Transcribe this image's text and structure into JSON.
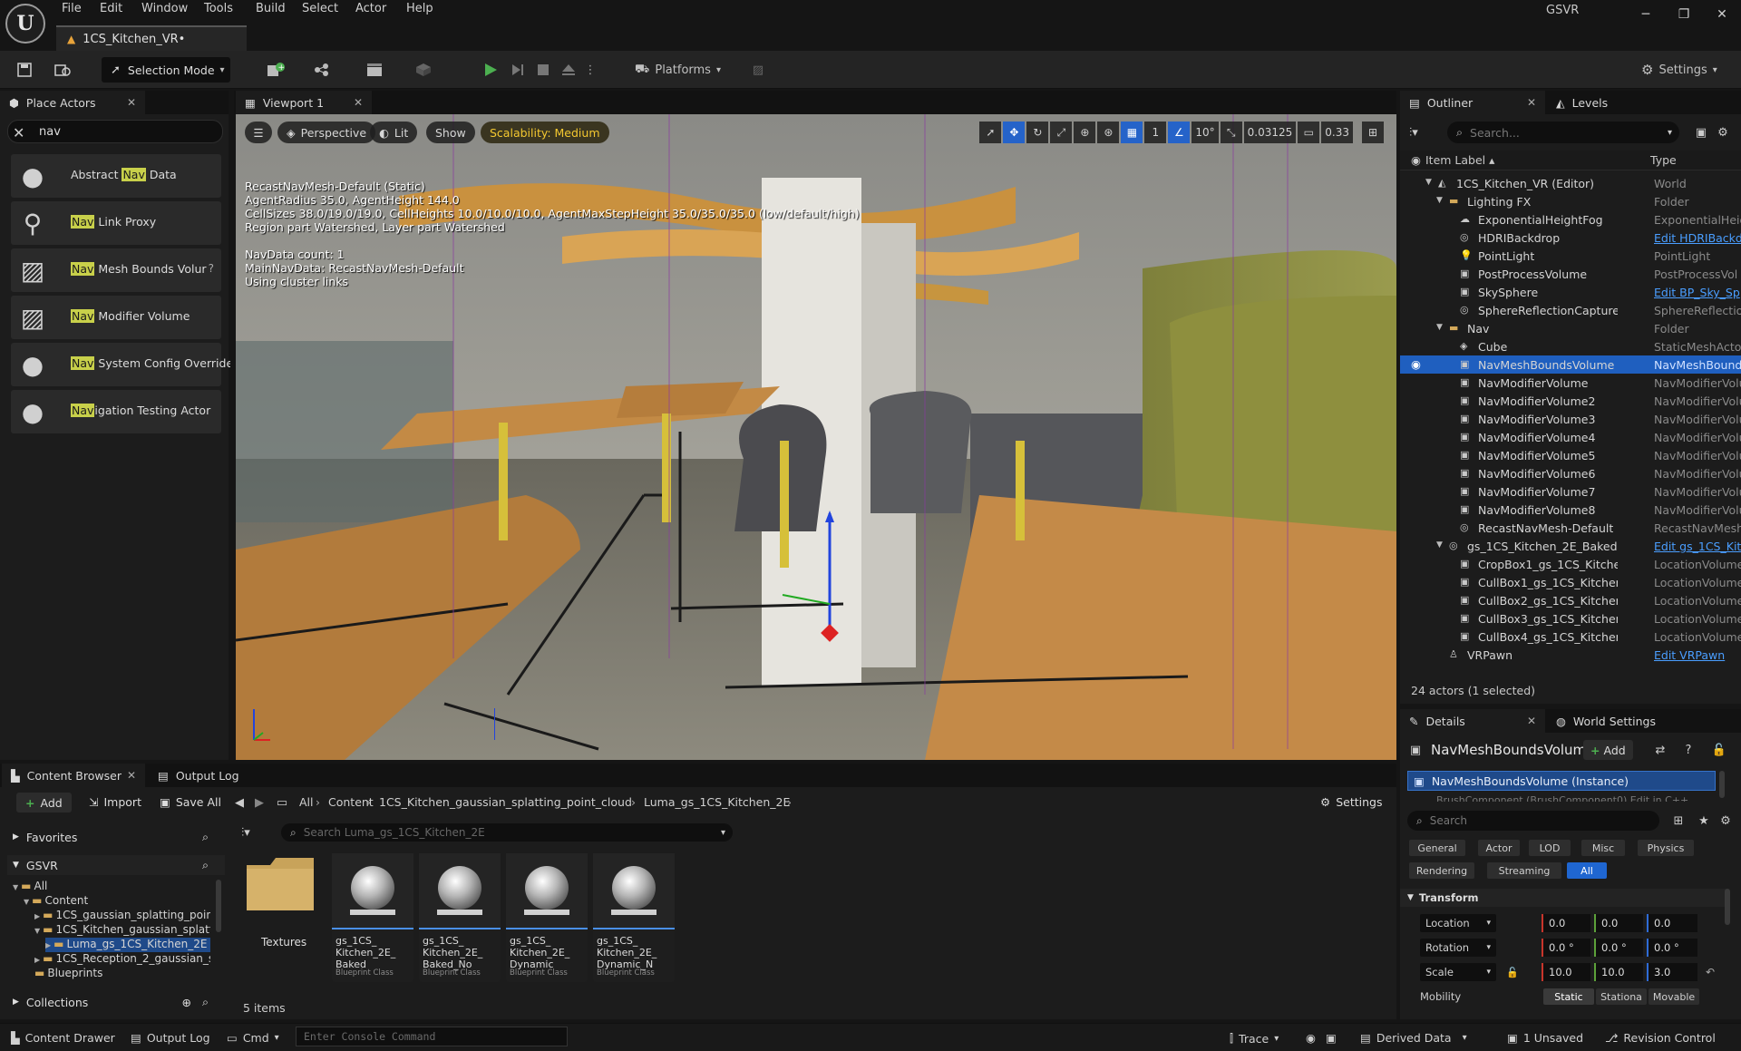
{
  "menu": [
    "File",
    "Edit",
    "Window",
    "Tools",
    "Build",
    "Select",
    "Actor",
    "Help"
  ],
  "project_tab": "1CS_Kitchen_VR•",
  "top_right_label": "GSVR",
  "toolbar": {
    "selection_mode": "Selection Mode",
    "platforms": "Platforms",
    "settings": "Settings"
  },
  "place_actors": {
    "tab": "Place Actors",
    "search_value": "nav",
    "items": [
      {
        "pre": "Abstract ",
        "hl": "Nav",
        "post": " Data"
      },
      {
        "pre": "",
        "hl": "Nav",
        "post": " Link Proxy"
      },
      {
        "pre": "",
        "hl": "Nav",
        "post": " Mesh Bounds Volur"
      },
      {
        "pre": "",
        "hl": "Nav",
        "post": " Modifier Volume"
      },
      {
        "pre": "",
        "hl": "Nav",
        "post": " System Config Override"
      },
      {
        "pre": "",
        "hl": "Nav",
        "post": "igation Testing Actor"
      }
    ]
  },
  "viewport": {
    "tab": "Viewport 1",
    "perspective": "Perspective",
    "lit": "Lit",
    "show": "Show",
    "scalability": "Scalability: Medium",
    "grid_snap": "1",
    "rotation_snap": "10°",
    "scale_snap": "0.03125",
    "camera_speed": "0.33",
    "nav_info": "RecastNavMesh-Default (Static)\nAgentRadius 35.0, AgentHeight 144.0\nCellSizes 38.0/19.0/19.0, CellHeights 10.0/10.0/10.0, AgentMaxStepHeight 35.0/35.0/35.0 (low/default/high)\nRegion part Watershed, Layer part Watershed\n\nNavData count: 1\nMainNavData: RecastNavMesh-Default\nUsing cluster links"
  },
  "outliner": {
    "tab": "Outliner",
    "levels_tab": "Levels",
    "search_placeholder": "Search...",
    "col_label": "Item Label",
    "col_type": "Type",
    "rows": [
      {
        "name": "1CS_Kitchen_VR (Editor)",
        "type": "World",
        "indent": 0,
        "kind": "world",
        "expand": "open"
      },
      {
        "name": "Lighting FX",
        "type": "Folder",
        "indent": 1,
        "kind": "folder",
        "expand": "open"
      },
      {
        "name": "ExponentialHeightFog",
        "type": "ExponentialHeig",
        "indent": 2,
        "kind": "fog"
      },
      {
        "name": "HDRIBackdrop",
        "type": "Edit HDRIBackd",
        "indent": 2,
        "kind": "actor",
        "link": true
      },
      {
        "name": "PointLight",
        "type": "PointLight",
        "indent": 2,
        "kind": "light"
      },
      {
        "name": "PostProcessVolume",
        "type": "PostProcessVol",
        "indent": 2,
        "kind": "volume"
      },
      {
        "name": "SkySphere",
        "type": "Edit BP_Sky_Sp",
        "indent": 2,
        "kind": "volume",
        "link": true
      },
      {
        "name": "SphereReflectionCapture",
        "type": "SphereReflectio",
        "indent": 2,
        "kind": "actor"
      },
      {
        "name": "Nav",
        "type": "Folder",
        "indent": 1,
        "kind": "folder",
        "expand": "open"
      },
      {
        "name": "Cube",
        "type": "StaticMeshActo",
        "indent": 2,
        "kind": "cube"
      },
      {
        "name": "NavMeshBoundsVolume",
        "type": "NavMeshBound",
        "indent": 2,
        "kind": "volume",
        "selected": true
      },
      {
        "name": "NavModifierVolume",
        "type": "NavModifierVolu",
        "indent": 2,
        "kind": "volume"
      },
      {
        "name": "NavModifierVolume2",
        "type": "NavModifierVolu",
        "indent": 2,
        "kind": "volume"
      },
      {
        "name": "NavModifierVolume3",
        "type": "NavModifierVolu",
        "indent": 2,
        "kind": "volume"
      },
      {
        "name": "NavModifierVolume4",
        "type": "NavModifierVolu",
        "indent": 2,
        "kind": "volume"
      },
      {
        "name": "NavModifierVolume5",
        "type": "NavModifierVolu",
        "indent": 2,
        "kind": "volume"
      },
      {
        "name": "NavModifierVolume6",
        "type": "NavModifierVolu",
        "indent": 2,
        "kind": "volume"
      },
      {
        "name": "NavModifierVolume7",
        "type": "NavModifierVolu",
        "indent": 2,
        "kind": "volume"
      },
      {
        "name": "NavModifierVolume8",
        "type": "NavModifierVolu",
        "indent": 2,
        "kind": "volume"
      },
      {
        "name": "RecastNavMesh-Default",
        "type": "RecastNavMesh",
        "indent": 2,
        "kind": "actor"
      },
      {
        "name": "gs_1CS_Kitchen_2E_Baked",
        "type": "Edit gs_1CS_Kit",
        "indent": 1,
        "kind": "actor",
        "expand": "open",
        "link": true
      },
      {
        "name": "CropBox1_gs_1CS_Kitchen_2E_",
        "type": "LocationVolume",
        "indent": 2,
        "kind": "volume"
      },
      {
        "name": "CullBox1_gs_1CS_Kitchen_2E_E",
        "type": "LocationVolume",
        "indent": 2,
        "kind": "volume"
      },
      {
        "name": "CullBox2_gs_1CS_Kitchen_2E_E",
        "type": "LocationVolume",
        "indent": 2,
        "kind": "volume"
      },
      {
        "name": "CullBox3_gs_1CS_Kitchen_2E_E",
        "type": "LocationVolume",
        "indent": 2,
        "kind": "volume"
      },
      {
        "name": "CullBox4_gs_1CS_Kitchen_2E_E",
        "type": "LocationVolume",
        "indent": 2,
        "kind": "volume"
      },
      {
        "name": "VRPawn",
        "type": "Edit VRPawn",
        "indent": 1,
        "kind": "pawn",
        "link": true
      }
    ],
    "count": "24 actors (1 selected)"
  },
  "details": {
    "tab": "Details",
    "world_settings_tab": "World Settings",
    "object_name": "NavMeshBoundsVolum",
    "add": "Add",
    "instance": "NavMeshBoundsVolume (Instance)",
    "component_partial": "BrushComponent (BrushComponent0)   Edit in C++",
    "search_placeholder": "Search",
    "categories": [
      "General",
      "Actor",
      "LOD",
      "Misc",
      "Physics",
      "Rendering",
      "Streaming",
      "All"
    ],
    "transform_header": "Transform",
    "location_label": "Location",
    "rotation_label": "Rotation",
    "scale_label": "Scale",
    "location": [
      "0.0",
      "0.0",
      "0.0"
    ],
    "rotation": [
      "0.0 °",
      "0.0 °",
      "0.0 °"
    ],
    "scale": [
      "10.0",
      "10.0",
      "3.0"
    ],
    "mobility_label": "Mobility",
    "mobility_options": [
      "Static",
      "Stationa",
      "Movable"
    ]
  },
  "content_browser": {
    "tab": "Content Browser",
    "output_log_tab": "Output Log",
    "add": "Add",
    "import": "Import",
    "save_all": "Save All",
    "settings": "Settings",
    "crumbs": [
      "All",
      "Content",
      "1CS_Kitchen_gaussian_splatting_point_cloud",
      "Luma_gs_1CS_Kitchen_2E"
    ],
    "favorites": "Favorites",
    "project": "GSVR",
    "collections": "Collections",
    "tree": [
      "All",
      "Content",
      "1CS_gaussian_splatting_point",
      "1CS_Kitchen_gaussian_splatti",
      "Luma_gs_1CS_Kitchen_2E",
      "1CS_Reception_2_gaussian_s",
      "Blueprints"
    ],
    "search_placeholder": "Search Luma_gs_1CS_Kitchen_2E",
    "folder": "Textures",
    "assets": [
      {
        "name": "gs_1CS_ Kitchen_2E_ Baked",
        "cls": "Blueprint Class"
      },
      {
        "name": "gs_1CS_ Kitchen_2E_ Baked_No",
        "cls": "Blueprint Class"
      },
      {
        "name": "gs_1CS_ Kitchen_2E_ Dynamic",
        "cls": "Blueprint Class"
      },
      {
        "name": "gs_1CS_ Kitchen_2E_ Dynamic_N",
        "cls": "Blueprint Class"
      }
    ],
    "item_count": "5 items"
  },
  "statusbar": {
    "content_drawer": "Content Drawer",
    "output_log": "Output Log",
    "cmd": "Cmd",
    "console_placeholder": "Enter Console Command",
    "trace": "Trace",
    "derived_data": "Derived Data",
    "unsaved": "1 Unsaved",
    "revision_control": "Revision Control"
  },
  "colors": {
    "accent": "#1f66d1",
    "play_green": "#4caf50",
    "highlight": "#c8d04a",
    "link": "#4a9eff"
  }
}
